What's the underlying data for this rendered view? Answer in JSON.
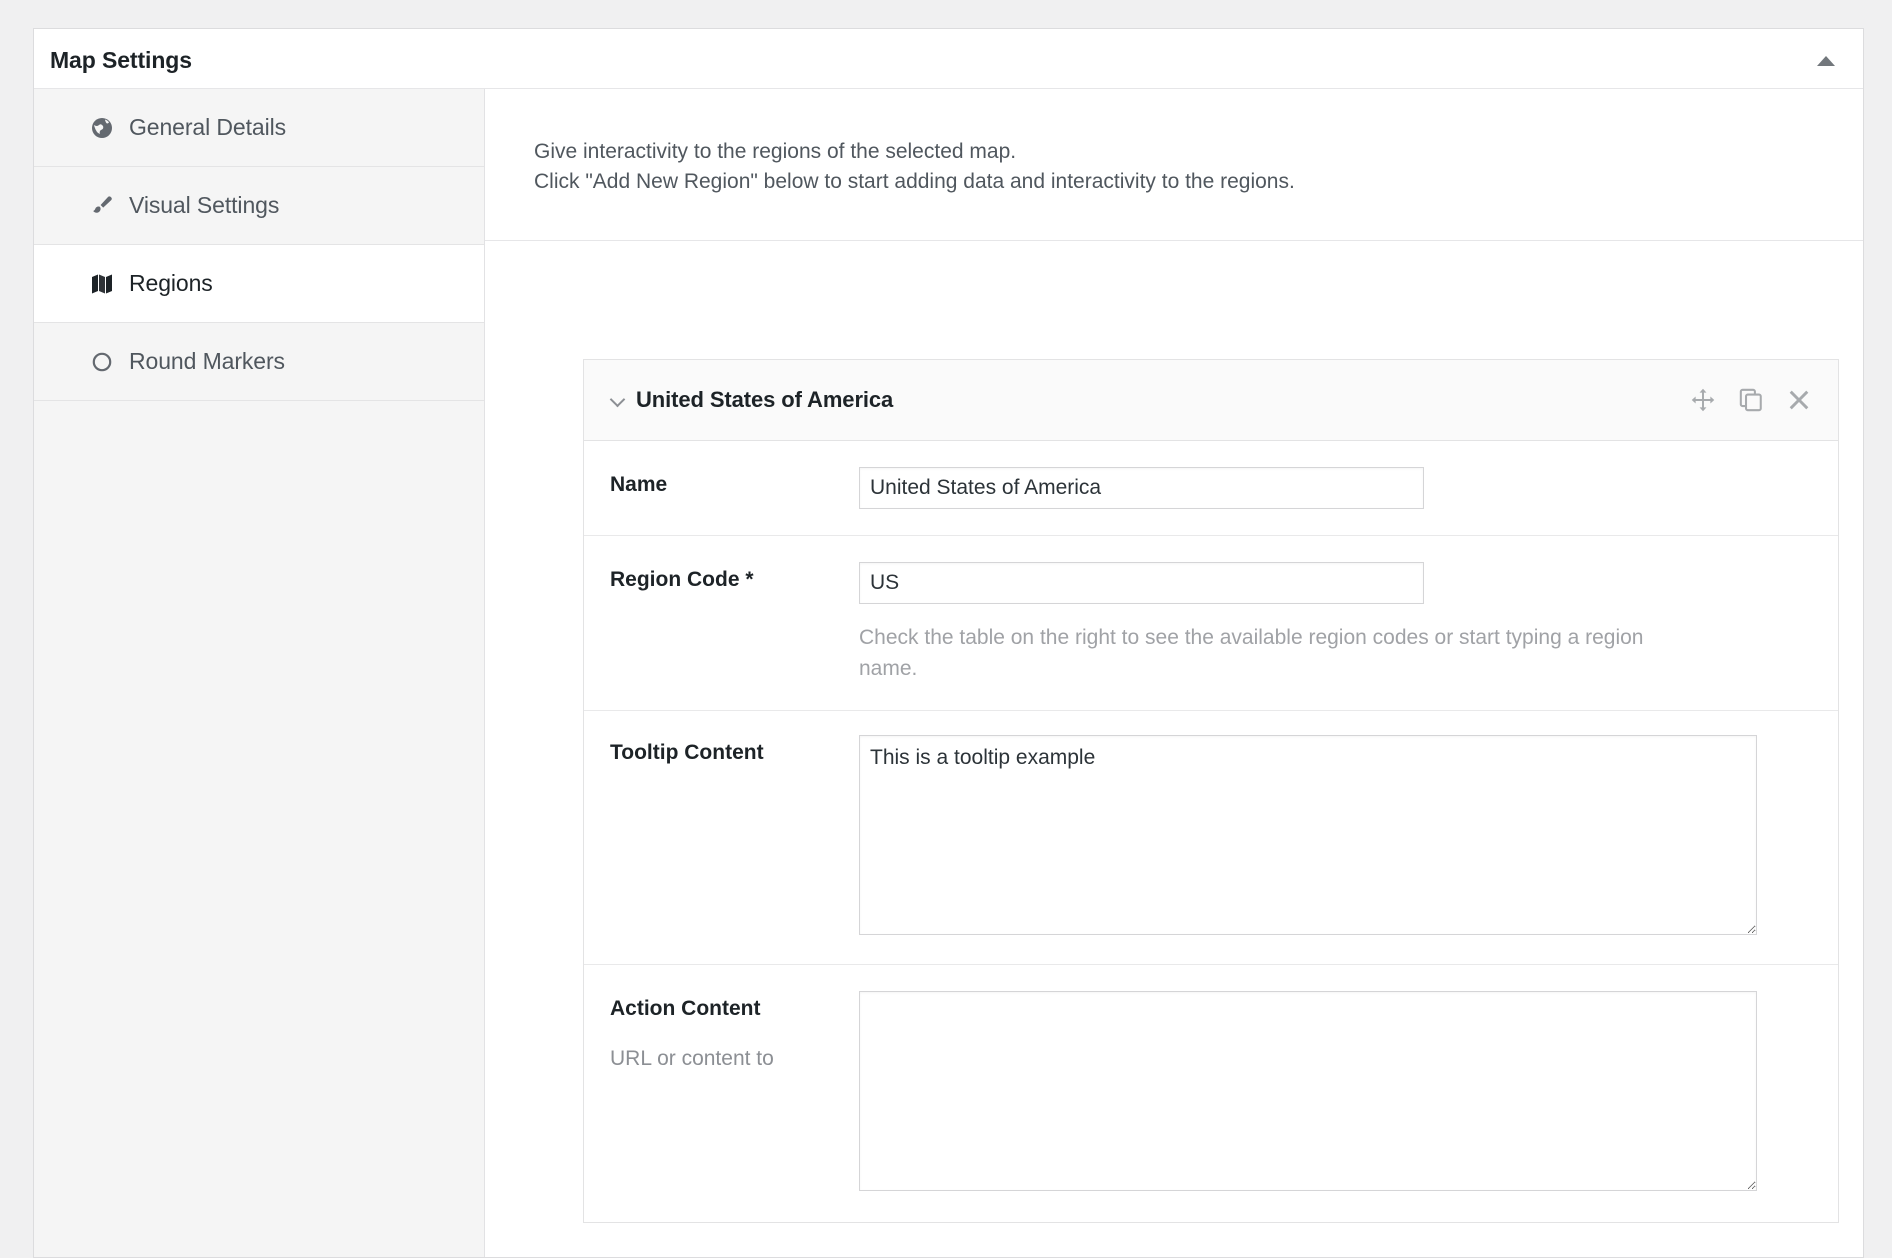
{
  "metabox": {
    "title": "Map Settings",
    "collapse_icon": "triangle-up-icon"
  },
  "sidebar": {
    "items": [
      {
        "label": "General Details",
        "icon": "globe-icon",
        "active": false
      },
      {
        "label": "Visual Settings",
        "icon": "paint-brush-icon",
        "active": false
      },
      {
        "label": "Regions",
        "icon": "map-icon",
        "active": true
      },
      {
        "label": "Round Markers",
        "icon": "circle-outline-icon",
        "active": false
      }
    ]
  },
  "content": {
    "intro_line_1": "Give interactivity to the regions of the selected map.",
    "intro_line_2": "Click \"Add New Region\" below to start adding data and interactivity to the regions."
  },
  "region_panel": {
    "header_title": "United States of America",
    "collapse_icon": "chevron-down-icon",
    "actions": [
      {
        "name": "move-icon",
        "title": "Move"
      },
      {
        "name": "duplicate-icon",
        "title": "Duplicate"
      },
      {
        "name": "close-icon",
        "title": "Remove"
      }
    ],
    "fields": {
      "name": {
        "label": "Name",
        "value": "United States of America"
      },
      "region_code": {
        "label": "Region Code *",
        "value": "US",
        "hint": "Check the table on the right to see the available region codes or start typing a region name."
      },
      "tooltip_content": {
        "label": "Tooltip Content",
        "value": "This is a tooltip example"
      },
      "action_content": {
        "label": "Action Content",
        "sub_label": "URL or content to",
        "value": ""
      }
    }
  },
  "colors": {
    "page_background": "#f0f0f1",
    "card_background": "#ffffff",
    "sidebar_background": "#f5f5f5",
    "border": "#dcdcde",
    "text_primary": "#1d2327",
    "text_secondary": "#50575e",
    "text_muted": "#a0a2a6",
    "panel_header": "#fafafa"
  }
}
